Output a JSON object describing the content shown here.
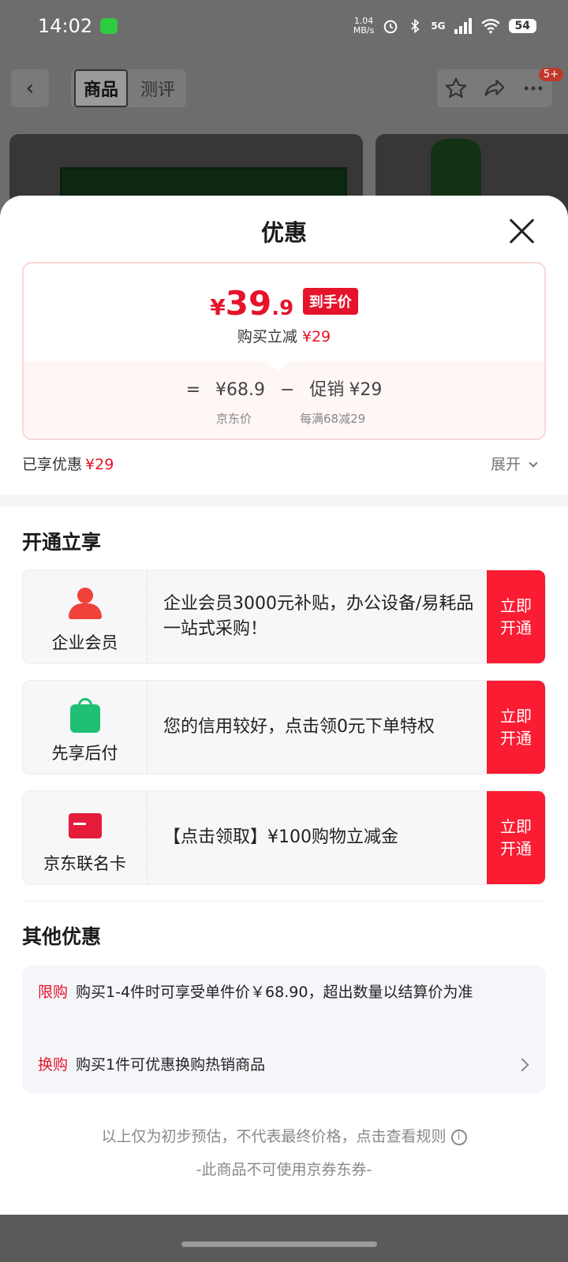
{
  "status_bar": {
    "time": "14:02",
    "net_speed_value": "1.04",
    "net_speed_unit": "MB/s",
    "network": "5G",
    "battery": "54"
  },
  "nav": {
    "tabs": [
      "商品",
      "测评"
    ],
    "active_tab": "商品",
    "badge": "5+"
  },
  "sheet": {
    "title": "优惠",
    "price_card": {
      "yen": "¥",
      "price_int": "39",
      "price_dec": ".9",
      "price_tag": "到手价",
      "reduce_label": "购买立减",
      "reduce_value": "¥29",
      "formula_eq": "=",
      "jd_price": "¥68.9",
      "minus": "−",
      "promo_label": "促销",
      "promo_value": "¥29",
      "jd_price_label": "京东价",
      "promo_rule": "每满68减29"
    },
    "enjoyed_label": "已享优惠",
    "enjoyed_value": "¥29",
    "expand_label": "展开",
    "open_section_title": "开通立享",
    "offers": [
      {
        "label": "企业会员",
        "desc": "企业会员3000元补贴，办公设备/易耗品一站式采购！",
        "action": "立即开通",
        "icon": "person-icon"
      },
      {
        "label": "先享后付",
        "desc": "您的信用较好，点击领0元下单特权",
        "action": "立即开通",
        "icon": "bag-icon"
      },
      {
        "label": "京东联名卡",
        "desc": "【点击领取】¥100购物立减金",
        "action": "立即开通",
        "icon": "card-icon"
      }
    ],
    "other_section_title": "其他优惠",
    "other_offers": [
      {
        "tag": "限购",
        "text": "购买1-4件时可享受单件价￥68.90，超出数量以结算价为准"
      },
      {
        "tag": "换购",
        "text": "购买1件可优惠换购热销商品"
      }
    ],
    "footnote": "以上仅为初步预估，不代表最终价格，点击查看规则",
    "footnote2": "-此商品不可使用京券东券-"
  },
  "colors": {
    "accent_red": "#e5142b",
    "action_red": "#fa1c32",
    "green": "#1fbf74"
  }
}
